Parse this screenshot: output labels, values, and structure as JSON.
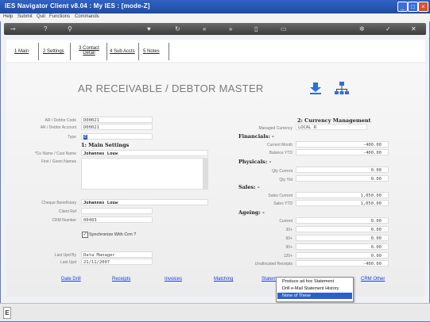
{
  "window": {
    "title": "IES Navigator Client v8.04 : My IES :     [mode-Z]"
  },
  "menu": [
    "Help",
    "Submit",
    "Quit",
    "Functions",
    "Commands"
  ],
  "tabs": [
    {
      "label": "1 Main"
    },
    {
      "label": "2 Settings"
    },
    {
      "label": "3 Contact Detail"
    },
    {
      "label": "4 Sub Accts"
    },
    {
      "label": "5 Notes"
    }
  ],
  "page": {
    "title": "AR RECEIVABLE / DEBTOR MASTER"
  },
  "left": {
    "debtor_code": {
      "label": "AR / Debtor Code",
      "value": "D00021"
    },
    "debtor_account": {
      "label": "AR / Debtor Account",
      "value": "D00021"
    },
    "type": {
      "label": "Type",
      "value": "E"
    },
    "main_settings": "1: Main Settings",
    "co_name": {
      "label": "*Co Name / Cust Name",
      "value": "Johannes Louw"
    },
    "first_names": {
      "label": "First / Given Names",
      "value": ""
    },
    "cheque_beneficiary": {
      "label": "Cheque Beneficiary",
      "value": "Johannes Louw"
    },
    "client_ref": {
      "label": "Client Ref",
      "value": ""
    },
    "crm_number": {
      "label": "CRM Number",
      "value": "00483"
    },
    "sync_crm": {
      "label": "Synchronize With Crm ?",
      "checked": true
    },
    "last_upd_by": {
      "label": "Last Upd By",
      "value": "Data Manager"
    },
    "last_upd": {
      "label": "Last Upd",
      "value": "21/11/2007"
    }
  },
  "right": {
    "currency_mgmt": "2: Currency Management",
    "managed_currency": {
      "label": "Managed Currency",
      "value": "LOCAL R"
    },
    "financials": "Financials: -",
    "current_month": {
      "label": "Current Month",
      "value": "-400.00"
    },
    "balance_ytd": {
      "label": "Balance YTD",
      "value": "-400.00"
    },
    "physicals": "Physicals: -",
    "qty_current": {
      "label": "Qty Current",
      "value": "0.00"
    },
    "qty_ytd": {
      "label": "Qty Ytd",
      "value": "0.00"
    },
    "sales": "Sales: -",
    "sales_current": {
      "label": "Sales Current",
      "value": "1,050.00"
    },
    "sales_ytd": {
      "label": "Sales YTD",
      "value": "1,050.00"
    },
    "ageing": "Ageing: -",
    "ageing_current": {
      "label": "Current",
      "value": "0.00"
    },
    "ageing_30": {
      "label": "30+",
      "value": "0.00"
    },
    "ageing_60": {
      "label": "60+",
      "value": "0.00"
    },
    "ageing_90": {
      "label": "90+",
      "value": "0.00"
    },
    "ageing_120": {
      "label": "120+",
      "value": "0.00"
    },
    "unallocated": {
      "label": "Unallocated Receipts",
      "value": "-400.00"
    }
  },
  "links": {
    "date_drill": "Date Drill",
    "receipts": "Receipts",
    "invoices": "Invoices",
    "matching": "Matching",
    "statement": "Statem",
    "crm_other": "CRM Other"
  },
  "context_menu": [
    "Produce ad hoc Statement",
    "Drill e-Mail Statement History",
    "None of These"
  ]
}
